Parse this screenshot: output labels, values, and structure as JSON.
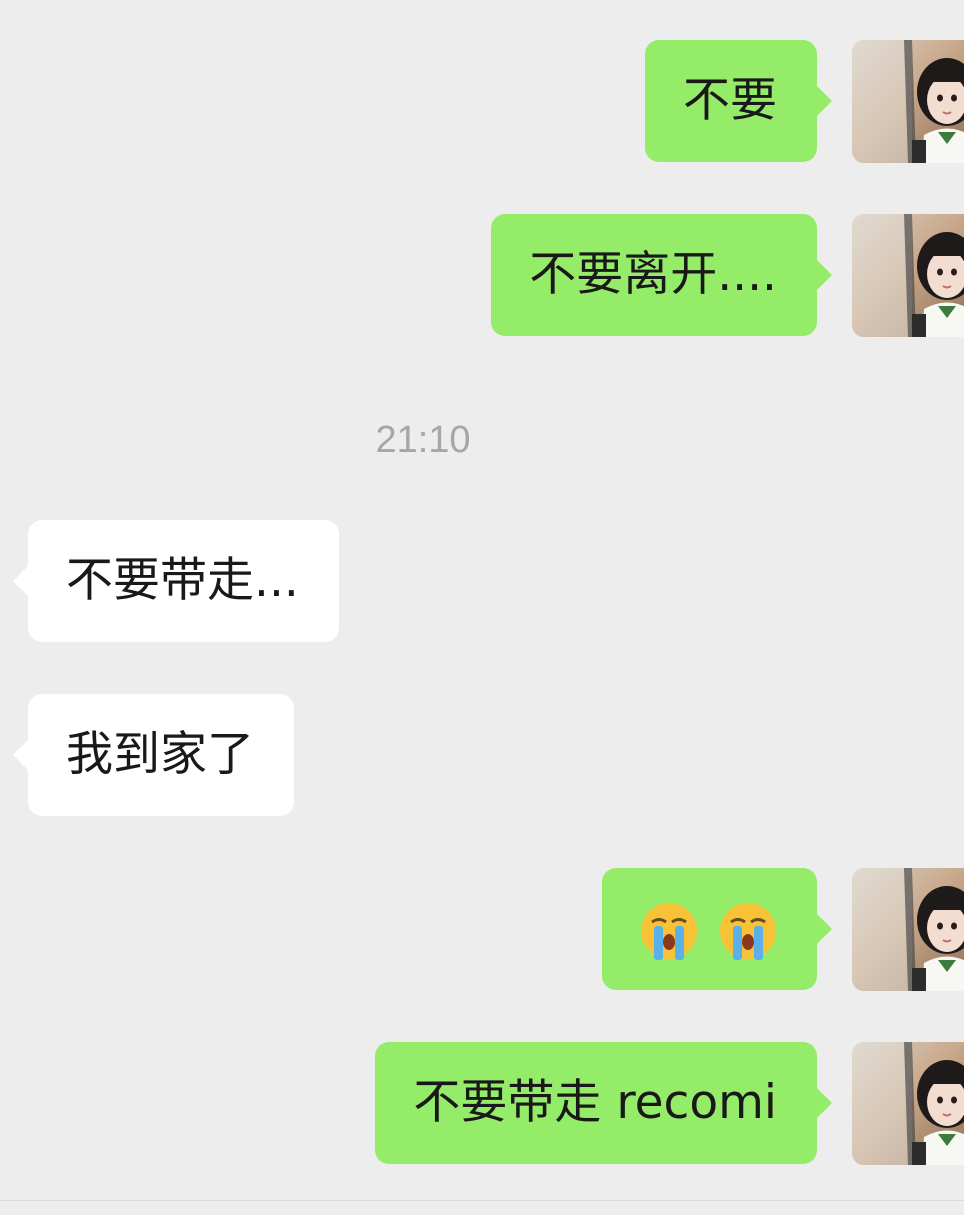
{
  "messages": [
    {
      "sender": "me",
      "text": "不要"
    },
    {
      "sender": "me",
      "text": "不要离开...."
    },
    {
      "sender": "them",
      "text": "不要带走..."
    },
    {
      "sender": "them",
      "text": "我到家了"
    },
    {
      "sender": "me",
      "emoji": [
        "loudly-crying-face",
        "loudly-crying-face"
      ]
    },
    {
      "sender": "me",
      "text": "不要带走 recomi"
    }
  ],
  "timestamp": "21:10",
  "colors": {
    "background": "#ededed",
    "outgoing_bubble": "#95ec69",
    "incoming_bubble": "#ffffff",
    "timestamp_text": "#a6a6a6"
  }
}
